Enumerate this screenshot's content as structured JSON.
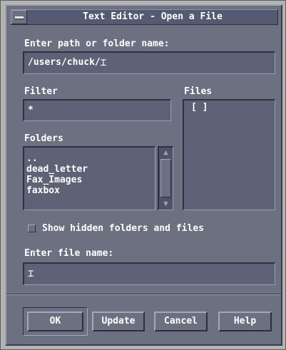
{
  "window": {
    "title": "Text Editor - Open a File"
  },
  "path": {
    "label": "Enter path or folder name:",
    "value": "/users/chuck/"
  },
  "filter": {
    "label": "Filter",
    "value": "*"
  },
  "files": {
    "label": "Files",
    "items": [
      "[    ]"
    ]
  },
  "folders": {
    "label": "Folders",
    "items": [
      "..",
      "dead_letter",
      "Fax_Images",
      "faxbox"
    ]
  },
  "options": {
    "show_hidden_label": "Show hidden folders and files",
    "show_hidden_checked": false
  },
  "filename": {
    "label": "Enter file name:",
    "value": ""
  },
  "buttons": {
    "ok": "OK",
    "update": "Update",
    "cancel": "Cancel",
    "help": "Help"
  },
  "icons": {
    "window_menu": "window-menu-icon",
    "scroll_up": "arrow-up-icon",
    "scroll_down": "arrow-down-icon",
    "text_cursor": "ibeam-cursor-icon"
  }
}
